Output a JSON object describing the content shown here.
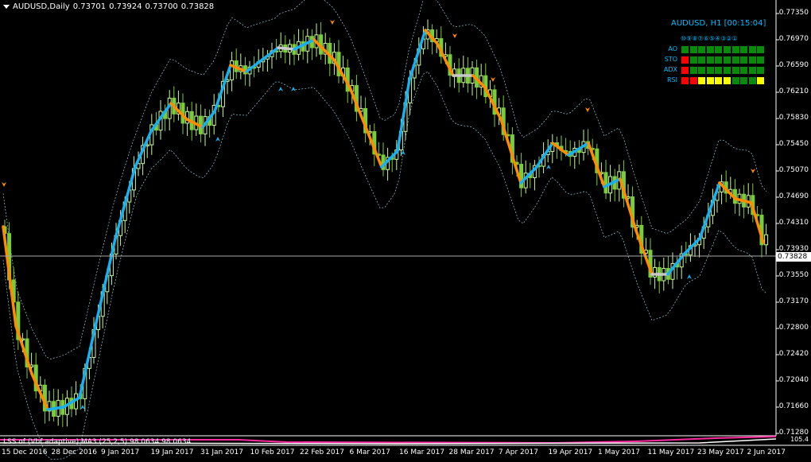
{
  "header": {
    "symbol": "AUDUSD,Daily",
    "open": "0.73701",
    "high": "0.73924",
    "low": "0.73700",
    "close": "0.73828"
  },
  "price_axis": [
    "0.77350",
    "0.76970",
    "0.76590",
    "0.76210",
    "0.75830",
    "0.75450",
    "0.75070",
    "0.74690",
    "0.74310",
    "0.73930",
    "0.73550",
    "0.73170",
    "0.72800",
    "0.72420",
    "0.72040",
    "0.71660",
    "0.71280"
  ],
  "current_price": "0.73828",
  "date_axis": [
    "15 Dec 2016",
    "28 Dec 2016",
    "9 Jan 2017",
    "19 Jan 2017",
    "31 Jan 2017",
    "10 Feb 2017",
    "22 Feb 2017",
    "6 Mar 2017",
    "16 Mar 2017",
    "28 Mar 2017",
    "7 Apr 2017",
    "19 Apr 2017",
    "1 May 2017",
    "11 May 2017",
    "23 May 2017",
    "2 Jun 2017"
  ],
  "dashboard": {
    "title": "AUDUSD, H1 [00:15:04]",
    "timeframes": "⑩⑨⑧⑦⑥⑤④③②①",
    "rows": [
      {
        "label": "AO",
        "cells": [
          "green",
          "green",
          "green",
          "green",
          "green",
          "green",
          "green",
          "green",
          "green",
          "green"
        ]
      },
      {
        "label": "STO",
        "cells": [
          "red",
          "green",
          "green",
          "green",
          "green",
          "green",
          "green",
          "green",
          "green",
          "green"
        ]
      },
      {
        "label": "ADX",
        "cells": [
          "red",
          "green",
          "green",
          "green",
          "green",
          "green",
          "green",
          "green",
          "green",
          "green"
        ]
      },
      {
        "label": "RSI",
        "cells": [
          "red",
          "red",
          "yellow",
          "yellow",
          "yellow",
          "yellow",
          "green",
          "green",
          "green",
          "yellow"
        ]
      }
    ]
  },
  "colors": {
    "green": "#0a8a0a",
    "red": "#ff0000",
    "yellow": "#ffff00",
    "up_trend": "#1ab0f0",
    "down_trend": "#ff8c00",
    "neutral": "#c8c8c8",
    "candle_bull": "#c8f7a0",
    "candle_bear": "#7acc3a"
  },
  "indicator": {
    "label": "LSS of (Vbf adaptive) MA3 (25,2,5) 98.0634 98.0634",
    "axis": "105.4"
  }
}
